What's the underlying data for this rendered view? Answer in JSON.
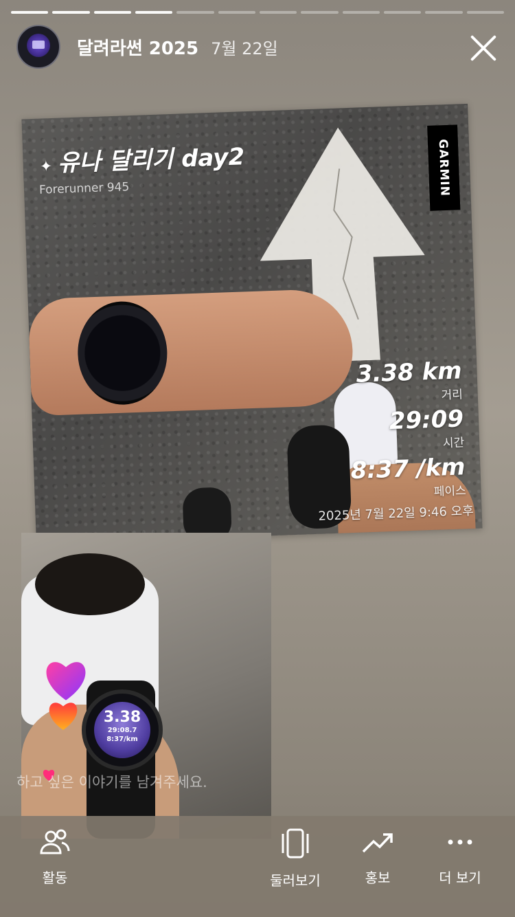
{
  "story": {
    "segments_total": 12,
    "segments_done": 4
  },
  "header": {
    "account": "달려라썬 2025",
    "date": "7월 22일"
  },
  "photo": {
    "activity_title": "유나 달리기 day2",
    "device": "Forerunner 945",
    "brand": "GARMIN",
    "stats": [
      {
        "value": "3.38 km",
        "label": "거리"
      },
      {
        "value": "29:09",
        "label": "시간"
      },
      {
        "value": "8:37 /km",
        "label": "페이스"
      }
    ],
    "timestamp": "2025년 7월 22일 9:46 오후"
  },
  "watch_screen": {
    "distance": "3.38",
    "time": "29:08.7",
    "pace": "8:37/km"
  },
  "reply": {
    "placeholder": "하고 싶은 이야기를 남겨주세요."
  },
  "bottom_bar": {
    "activity": "활동",
    "browse": "둘러보기",
    "promote": "홍보",
    "more": "더 보기"
  },
  "colors": {
    "background": "#a49d92",
    "bottom_bar": "#827a6e",
    "heart_gradient": [
      "#ff3fa4",
      "#8a37ff"
    ]
  }
}
